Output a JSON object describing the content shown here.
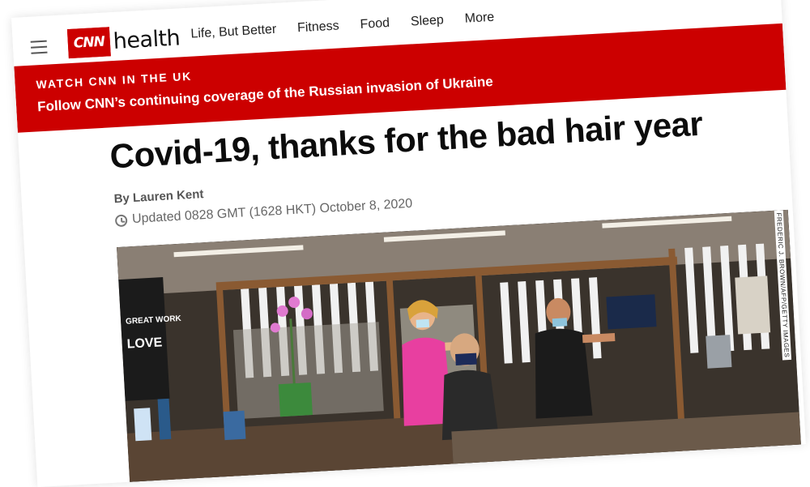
{
  "brand": {
    "logo_box": "CNN",
    "logo_word": "health"
  },
  "nav": {
    "links": [
      "Life, But Better",
      "Fitness",
      "Food",
      "Sleep",
      "More"
    ]
  },
  "banner": {
    "kicker": "WATCH CNN IN THE UK",
    "link": "Follow CNN’s continuing coverage of the Russian invasion of Ukraine"
  },
  "article": {
    "headline": "Covid-19, thanks for the bad hair year",
    "byline": "By Lauren Kent",
    "timestamp": "Updated 0828 GMT (1628 HKT) October 8, 2020",
    "photo_credit": "FREDERIC J. BROWN/AFP/GETTY IMAGES"
  },
  "colors": {
    "accent": "#cc0000",
    "text": "#0c0c0c",
    "muted": "#666666"
  },
  "icons": {
    "menu": "hamburger-icon",
    "time": "clock-icon"
  },
  "photo_sign": {
    "line1": "LOVE",
    "line2": "GREAT WORK"
  }
}
